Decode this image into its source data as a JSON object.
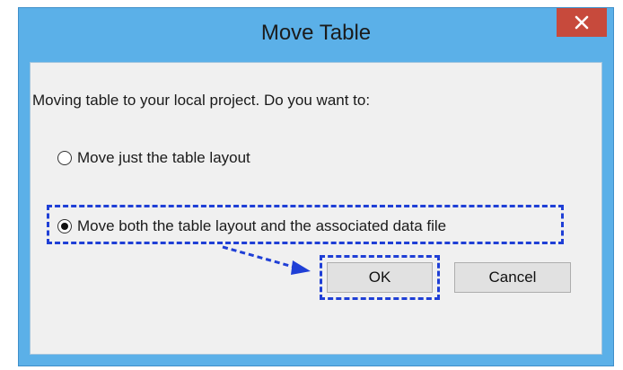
{
  "dialog": {
    "title": "Move Table",
    "close_glyph": "×",
    "prompt": "Moving table to your local project. Do you want to:",
    "options": [
      {
        "label": "Move just the table layout",
        "selected": false
      },
      {
        "label": "Move both the table layout and the associated data file",
        "selected": true
      }
    ],
    "buttons": {
      "ok": "OK",
      "cancel": "Cancel"
    }
  },
  "colors": {
    "window_frame": "#5bb0e8",
    "close_button": "#c74a3c",
    "client_background": "#f0f0f0",
    "annotation": "#1f3fd6"
  },
  "icons": {
    "close": "close-icon",
    "annotation_arrow": "dashed-arrow-icon"
  }
}
